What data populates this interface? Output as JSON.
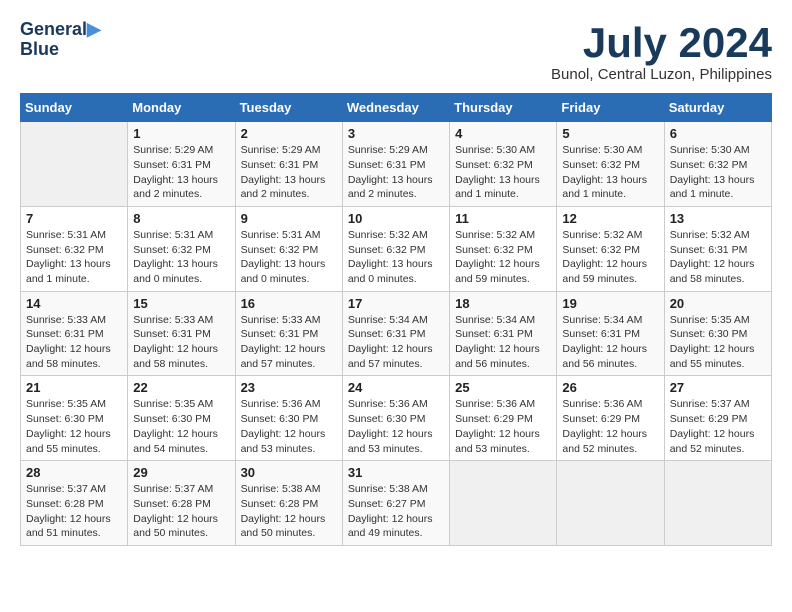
{
  "header": {
    "logo_line1": "General",
    "logo_line2": "Blue",
    "month": "July 2024",
    "location": "Bunol, Central Luzon, Philippines"
  },
  "weekdays": [
    "Sunday",
    "Monday",
    "Tuesday",
    "Wednesday",
    "Thursday",
    "Friday",
    "Saturday"
  ],
  "weeks": [
    [
      {
        "day": "",
        "info": ""
      },
      {
        "day": "1",
        "info": "Sunrise: 5:29 AM\nSunset: 6:31 PM\nDaylight: 13 hours\nand 2 minutes."
      },
      {
        "day": "2",
        "info": "Sunrise: 5:29 AM\nSunset: 6:31 PM\nDaylight: 13 hours\nand 2 minutes."
      },
      {
        "day": "3",
        "info": "Sunrise: 5:29 AM\nSunset: 6:31 PM\nDaylight: 13 hours\nand 2 minutes."
      },
      {
        "day": "4",
        "info": "Sunrise: 5:30 AM\nSunset: 6:32 PM\nDaylight: 13 hours\nand 1 minute."
      },
      {
        "day": "5",
        "info": "Sunrise: 5:30 AM\nSunset: 6:32 PM\nDaylight: 13 hours\nand 1 minute."
      },
      {
        "day": "6",
        "info": "Sunrise: 5:30 AM\nSunset: 6:32 PM\nDaylight: 13 hours\nand 1 minute."
      }
    ],
    [
      {
        "day": "7",
        "info": "Sunrise: 5:31 AM\nSunset: 6:32 PM\nDaylight: 13 hours\nand 1 minute."
      },
      {
        "day": "8",
        "info": "Sunrise: 5:31 AM\nSunset: 6:32 PM\nDaylight: 13 hours\nand 0 minutes."
      },
      {
        "day": "9",
        "info": "Sunrise: 5:31 AM\nSunset: 6:32 PM\nDaylight: 13 hours\nand 0 minutes."
      },
      {
        "day": "10",
        "info": "Sunrise: 5:32 AM\nSunset: 6:32 PM\nDaylight: 13 hours\nand 0 minutes."
      },
      {
        "day": "11",
        "info": "Sunrise: 5:32 AM\nSunset: 6:32 PM\nDaylight: 12 hours\nand 59 minutes."
      },
      {
        "day": "12",
        "info": "Sunrise: 5:32 AM\nSunset: 6:32 PM\nDaylight: 12 hours\nand 59 minutes."
      },
      {
        "day": "13",
        "info": "Sunrise: 5:32 AM\nSunset: 6:31 PM\nDaylight: 12 hours\nand 58 minutes."
      }
    ],
    [
      {
        "day": "14",
        "info": "Sunrise: 5:33 AM\nSunset: 6:31 PM\nDaylight: 12 hours\nand 58 minutes."
      },
      {
        "day": "15",
        "info": "Sunrise: 5:33 AM\nSunset: 6:31 PM\nDaylight: 12 hours\nand 58 minutes."
      },
      {
        "day": "16",
        "info": "Sunrise: 5:33 AM\nSunset: 6:31 PM\nDaylight: 12 hours\nand 57 minutes."
      },
      {
        "day": "17",
        "info": "Sunrise: 5:34 AM\nSunset: 6:31 PM\nDaylight: 12 hours\nand 57 minutes."
      },
      {
        "day": "18",
        "info": "Sunrise: 5:34 AM\nSunset: 6:31 PM\nDaylight: 12 hours\nand 56 minutes."
      },
      {
        "day": "19",
        "info": "Sunrise: 5:34 AM\nSunset: 6:31 PM\nDaylight: 12 hours\nand 56 minutes."
      },
      {
        "day": "20",
        "info": "Sunrise: 5:35 AM\nSunset: 6:30 PM\nDaylight: 12 hours\nand 55 minutes."
      }
    ],
    [
      {
        "day": "21",
        "info": "Sunrise: 5:35 AM\nSunset: 6:30 PM\nDaylight: 12 hours\nand 55 minutes."
      },
      {
        "day": "22",
        "info": "Sunrise: 5:35 AM\nSunset: 6:30 PM\nDaylight: 12 hours\nand 54 minutes."
      },
      {
        "day": "23",
        "info": "Sunrise: 5:36 AM\nSunset: 6:30 PM\nDaylight: 12 hours\nand 53 minutes."
      },
      {
        "day": "24",
        "info": "Sunrise: 5:36 AM\nSunset: 6:30 PM\nDaylight: 12 hours\nand 53 minutes."
      },
      {
        "day": "25",
        "info": "Sunrise: 5:36 AM\nSunset: 6:29 PM\nDaylight: 12 hours\nand 53 minutes."
      },
      {
        "day": "26",
        "info": "Sunrise: 5:36 AM\nSunset: 6:29 PM\nDaylight: 12 hours\nand 52 minutes."
      },
      {
        "day": "27",
        "info": "Sunrise: 5:37 AM\nSunset: 6:29 PM\nDaylight: 12 hours\nand 52 minutes."
      }
    ],
    [
      {
        "day": "28",
        "info": "Sunrise: 5:37 AM\nSunset: 6:28 PM\nDaylight: 12 hours\nand 51 minutes."
      },
      {
        "day": "29",
        "info": "Sunrise: 5:37 AM\nSunset: 6:28 PM\nDaylight: 12 hours\nand 50 minutes."
      },
      {
        "day": "30",
        "info": "Sunrise: 5:38 AM\nSunset: 6:28 PM\nDaylight: 12 hours\nand 50 minutes."
      },
      {
        "day": "31",
        "info": "Sunrise: 5:38 AM\nSunset: 6:27 PM\nDaylight: 12 hours\nand 49 minutes."
      },
      {
        "day": "",
        "info": ""
      },
      {
        "day": "",
        "info": ""
      },
      {
        "day": "",
        "info": ""
      }
    ]
  ]
}
